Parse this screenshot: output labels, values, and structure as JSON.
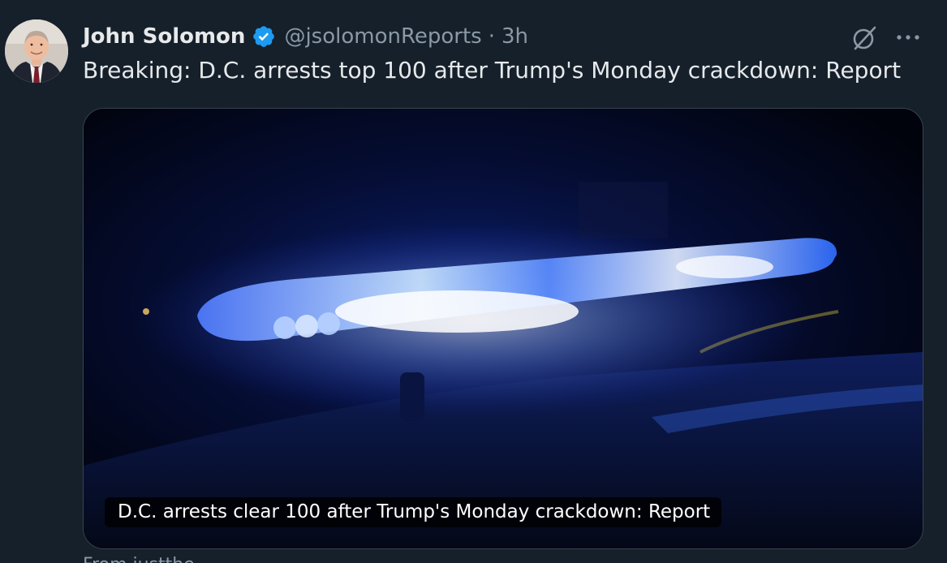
{
  "author": {
    "display_name": "John Solomon",
    "handle": "@jsolomonReports",
    "separator": "·",
    "timestamp": "3h",
    "verified": true
  },
  "tweet": {
    "text": "Breaking: D.C. arrests top 100 after Trump's Monday crackdown: Report"
  },
  "card": {
    "caption": "D.C. arrests clear 100 after Trump's Monday crackdown: Report",
    "image_subject": "police-light-bar-blue"
  },
  "footer": {
    "source_text": "From justthe"
  },
  "icons": {
    "verified": "verified-badge-icon",
    "grok": "grok-icon",
    "more": "more-icon"
  },
  "colors": {
    "background": "#15202b",
    "primary_text": "#e7e9ea",
    "secondary_text": "#8b98a5",
    "verified_blue": "#1d9bf0",
    "border": "#38444d"
  }
}
